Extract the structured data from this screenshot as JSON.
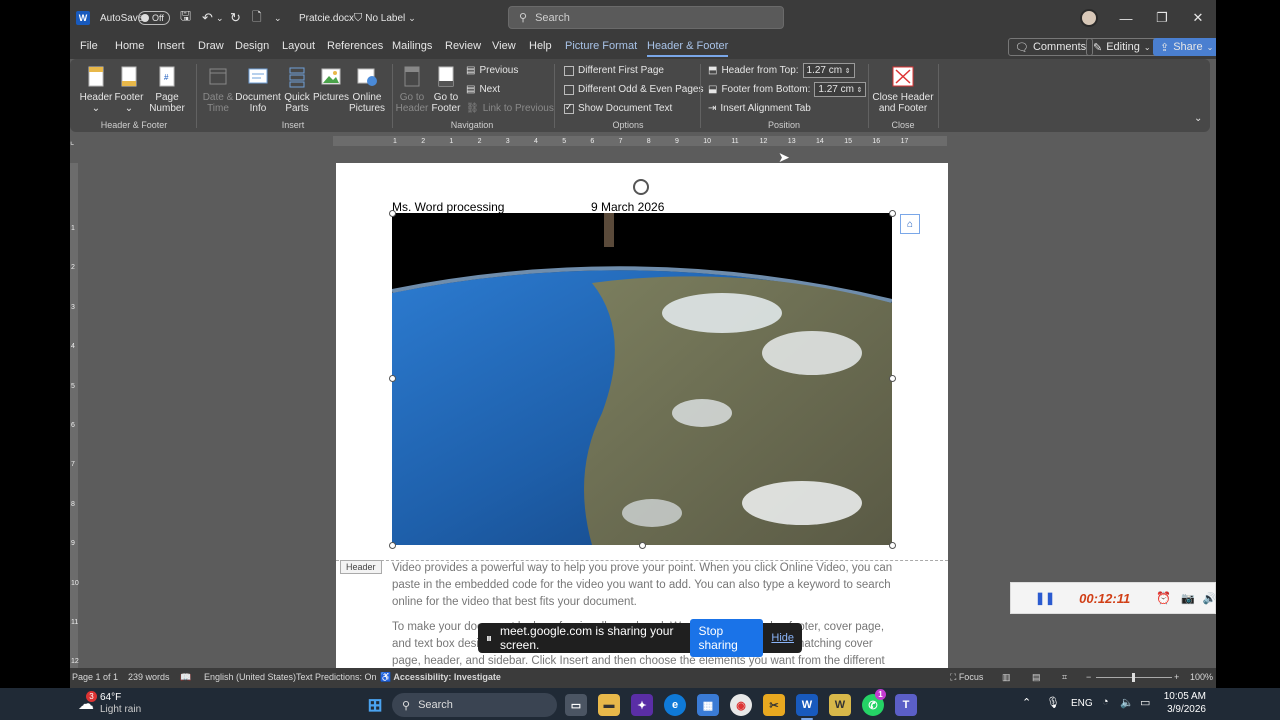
{
  "titlebar": {
    "autosave_label": "AutoSave",
    "autosave_state": "Off",
    "doc_name": "Pratcie.docx",
    "label_text": "No Label",
    "search_placeholder": "Search"
  },
  "menubar": {
    "tabs": [
      "File",
      "Home",
      "Insert",
      "Draw",
      "Design",
      "Layout",
      "References",
      "Mailings",
      "Review",
      "View",
      "Help",
      "Picture Format",
      "Header & Footer"
    ],
    "active_tab": "Header & Footer",
    "comments_label": "Comments",
    "editing_label": "Editing",
    "share_label": "Share"
  },
  "ribbon": {
    "header_footer": {
      "header": "Header",
      "footer": "Footer",
      "page_number_1": "Page",
      "page_number_2": "Number",
      "group": "Header & Footer"
    },
    "insert": {
      "date_1": "Date &",
      "date_2": "Time",
      "docinfo_1": "Document",
      "docinfo_2": "Info",
      "quick_1": "Quick",
      "quick_2": "Parts",
      "pictures": "Pictures",
      "online_1": "Online",
      "online_2": "Pictures",
      "group": "Insert"
    },
    "navigation": {
      "goto_header_1": "Go to",
      "goto_header_2": "Header",
      "goto_footer_1": "Go to",
      "goto_footer_2": "Footer",
      "previous": "Previous",
      "next": "Next",
      "link_previous": "Link to Previous",
      "group": "Navigation"
    },
    "options": {
      "diff_first": "Different First Page",
      "diff_odd_even": "Different Odd & Even Pages",
      "show_doc_text": "Show Document Text",
      "group": "Options"
    },
    "position": {
      "header_from_top": "Header from Top:",
      "header_value": "1.27 cm",
      "footer_from_bottom": "Footer from Bottom:",
      "footer_value": "1.27 cm",
      "insert_alignment": "Insert Alignment Tab",
      "group": "Position"
    },
    "close": {
      "label_1": "Close Header",
      "label_2": "and Footer",
      "group": "Close"
    }
  },
  "ruler": {
    "ticks": [
      "1",
      "2",
      "1",
      "2",
      "3",
      "4",
      "5",
      "6",
      "7",
      "8",
      "9",
      "10",
      "11",
      "12",
      "13",
      "14",
      "15",
      "16",
      "17"
    ]
  },
  "vruler": {
    "ticks": [
      "1",
      "2",
      "3",
      "4",
      "5",
      "6",
      "7",
      "8",
      "9",
      "10",
      "11",
      "12"
    ]
  },
  "document": {
    "header_left": "Ms. Word processing",
    "header_date": "9 March 2026",
    "header_tag": "Header",
    "para1": "Video provides a powerful way to help you prove your point. When you click Online Video, you can paste in the embedded code for the video you want to add. You can also type a keyword to search online for the video that best fits your document.",
    "para2": "To make your document look professionally produced, Word provides header, footer, cover page, and text box designs that complement each other. For example, you can add a matching cover page, header, and sidebar. Click Insert and then choose the elements you want from the different"
  },
  "sharebar": {
    "message": "meet.google.com is sharing your screen.",
    "stop_label": "Stop sharing",
    "hide_label": "Hide"
  },
  "recorder": {
    "time": "00:12:11"
  },
  "statusbar": {
    "page": "Page 1 of 1",
    "words": "239 words",
    "language": "English (United States)",
    "predictions": "Text Predictions: On",
    "accessibility": "Accessibility: Investigate",
    "focus": "Focus",
    "zoom": "100%"
  },
  "taskbar": {
    "weather_temp": "64°F",
    "weather_desc": "Light rain",
    "weather_badge": "3",
    "search_label": "Search",
    "lang": "ENG",
    "time": "10:05 AM",
    "date": "3/9/2026",
    "whatsapp_badge": "1"
  },
  "colors": {
    "word_blue": "#185abd",
    "accent": "#1a73e8",
    "record_red": "#d13f16"
  }
}
